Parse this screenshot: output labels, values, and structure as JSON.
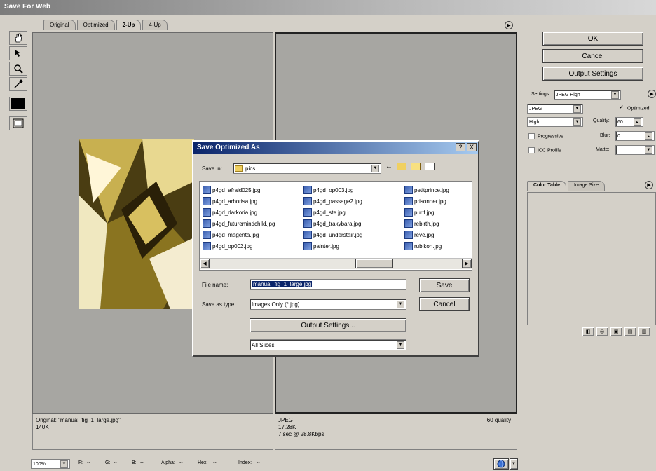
{
  "window": {
    "title": "Save For Web"
  },
  "tabs": [
    "Original",
    "Optimized",
    "2-Up",
    "4-Up"
  ],
  "left_pane": {
    "info_line1": "Original: \"manual_fig_1_large.jpg\"",
    "info_line2": "140K"
  },
  "right_pane": {
    "info_line1": "JPEG",
    "info_line2": "17.28K",
    "info_line3": "7 sec @ 28.8Kbps",
    "quality_label": "60 quality"
  },
  "side_buttons": {
    "ok": "OK",
    "cancel": "Cancel",
    "output_settings": "Output Settings"
  },
  "settings": {
    "settings_label": "Settings:",
    "settings_value": "JPEG High",
    "format_value": "JPEG",
    "optimized_label": "Optimized",
    "quality_preset": "High",
    "quality_label": "Quality:",
    "quality_value": "60",
    "progressive_label": "Progressive",
    "blur_label": "Blur:",
    "blur_value": "0",
    "icc_label": "ICC Profile",
    "matte_label": "Matte:"
  },
  "panel_tabs": [
    "Color Table",
    "Image Size"
  ],
  "dialog": {
    "title": "Save Optimized As",
    "help": "?",
    "close": "X",
    "save_in_label": "Save in:",
    "save_in_value": "pics",
    "files": [
      [
        "p4gd_afraid025.jpg",
        "p4gd_arborisa.jpg",
        "p4gd_darkoria.jpg",
        "p4gd_futuremindchild.jpg",
        "p4gd_magenta.jpg",
        "p4gd_op002.jpg"
      ],
      [
        "p4gd_op003.jpg",
        "p4gd_passage2.jpg",
        "p4gd_ste.jpg",
        "p4gd_trakybara.jpg",
        "p4gd_understair.jpg",
        "painter.jpg"
      ],
      [
        "petitprince.jpg",
        "prisonner.jpg",
        "purif.jpg",
        "rebirth.jpg",
        "reve.jpg",
        "rubikon.jpg"
      ]
    ],
    "file_name_label": "File name:",
    "file_name_value": "manual_fig_1_large.jpg",
    "save_as_label": "Save as type:",
    "save_as_value": "Images Only (*.jpg)",
    "save_button": "Save",
    "cancel_button": "Cancel",
    "output_settings_button": "Output Settings...",
    "slices_value": "All Slices"
  },
  "statusbar": {
    "zoom": "100%",
    "r_label": "R:",
    "r_value": "--",
    "g_label": "G:",
    "g_value": "--",
    "b_label": "B:",
    "b_value": "--",
    "alpha_label": "Alpha:",
    "alpha_value": "--",
    "hex_label": "Hex:",
    "hex_value": "--",
    "index_label": "Index:",
    "index_value": "--"
  }
}
